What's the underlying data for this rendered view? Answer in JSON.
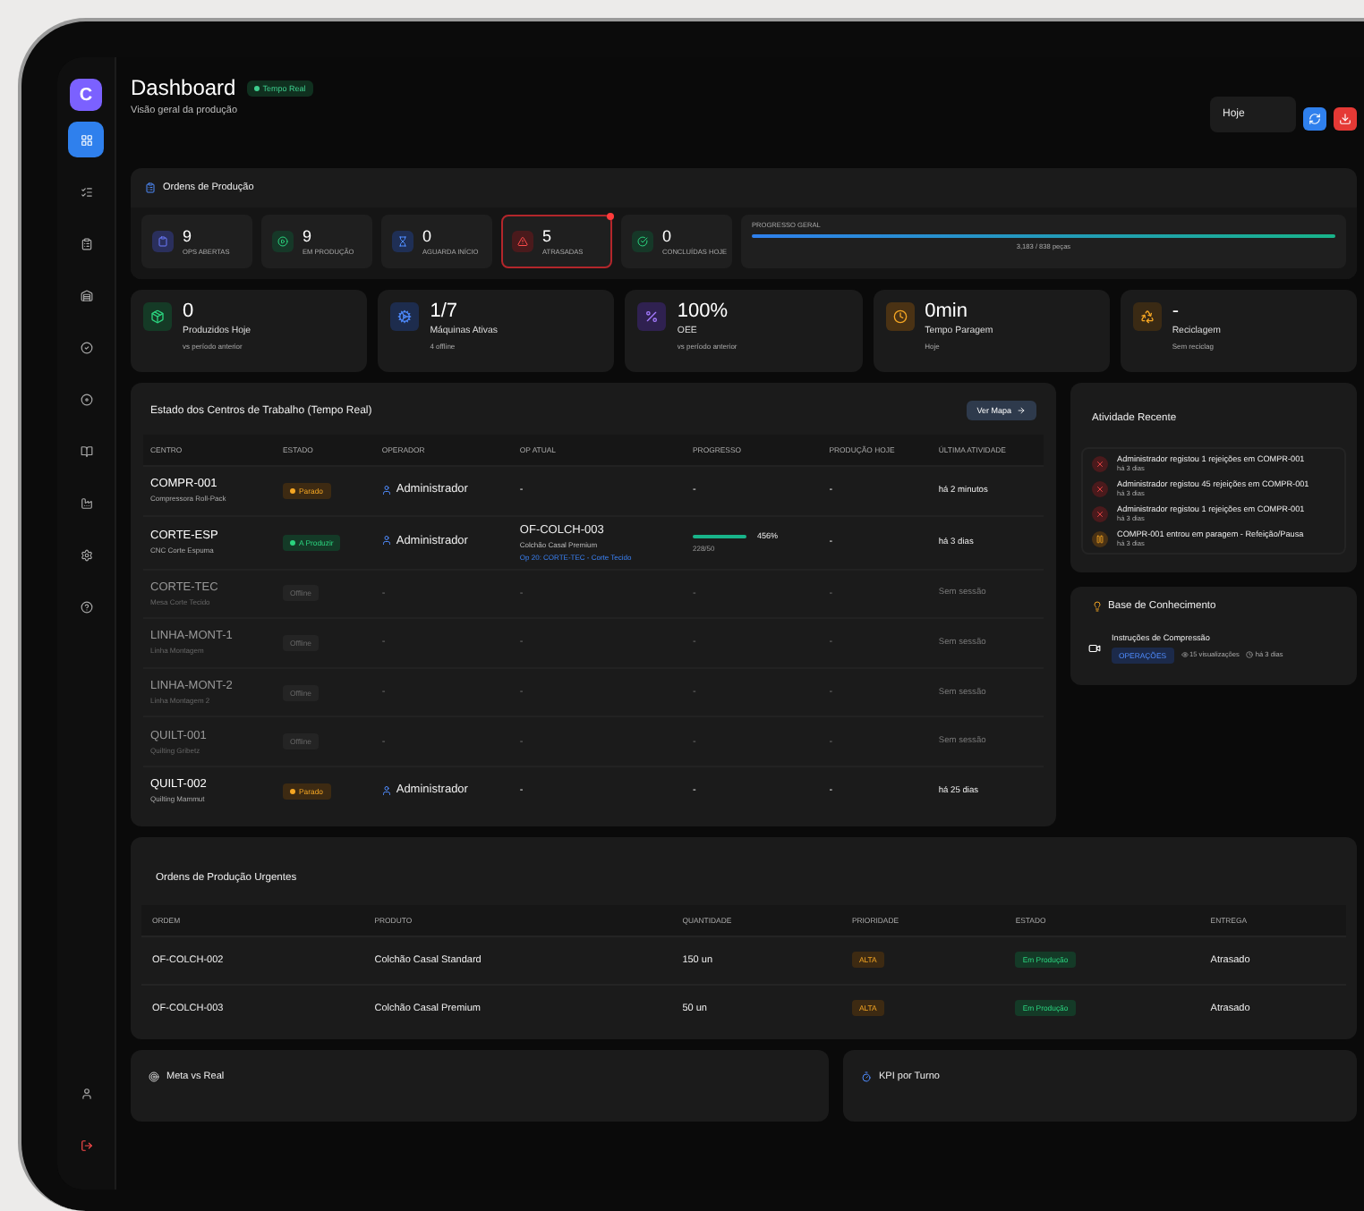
{
  "sidebar": {
    "logo": "C",
    "items": [
      {
        "selected": true
      },
      {
        "selected": false
      },
      {
        "selected": false
      },
      {
        "selected": false
      },
      {
        "selected": false
      },
      {
        "selected": false
      },
      {
        "selected": false
      },
      {
        "selected": false
      },
      {
        "selected": false
      },
      {
        "selected": false
      }
    ]
  },
  "header": {
    "title": "Dashboard",
    "badge": "Tempo Real",
    "subtitle": "Visão geral da produção",
    "period": "Hoje"
  },
  "orders_panel": {
    "title": "Ordens de Produção",
    "stats": [
      {
        "value": "9",
        "label": "OPS ABERTAS",
        "selected": false
      },
      {
        "value": "9",
        "label": "EM PRODUÇÃO",
        "selected": false
      },
      {
        "value": "0",
        "label": "AGUARDA INÍCIO",
        "selected": false
      },
      {
        "value": "5",
        "label": "ATRASADAS",
        "selected": true
      },
      {
        "value": "0",
        "label": "CONCLUÍDAS HOJE",
        "selected": false
      }
    ],
    "progress": {
      "label": "PROGRESSO GERAL",
      "level": 1,
      "reading": "3,183 / 838 peças"
    }
  },
  "kpis": [
    {
      "value": "0",
      "label": "Produzidos Hoje",
      "note": "vs período anterior"
    },
    {
      "value": "1/7",
      "label": "Máquinas Ativas",
      "note": "4 offline"
    },
    {
      "value": "100%",
      "label": "OEE",
      "note": "vs período anterior"
    },
    {
      "value": "0min",
      "label": "Tempo Paragem",
      "note": "Hoje"
    },
    {
      "value": "-",
      "label": "Reciclagem",
      "note": "Sem reciclag"
    }
  ],
  "work_centers": {
    "title": "Estado dos Centros de Trabalho (Tempo Real)",
    "button": "Ver Mapa",
    "columns": [
      "CENTRO",
      "ESTADO",
      "OPERADOR",
      "OP ATUAL",
      "PROGRESSO",
      "PRODUÇÃO HOJE",
      "ÚLTIMA ATIVIDADE"
    ],
    "rows": [
      {
        "code": "COMPR-001",
        "name": "Compressora Roll-Pack",
        "status": {
          "kind": "stopped",
          "label": "Parado"
        },
        "operator": "Administrador",
        "op": "-",
        "progress": "-",
        "today": "-",
        "last": "há 2 minutos"
      },
      {
        "code": "CORTE-ESP",
        "name": "CNC Corte Espuma",
        "status": {
          "kind": "running",
          "label": "A Produzir"
        },
        "operator": "Administrador",
        "op": {
          "code": "OF-COLCH-003",
          "product": "Colchão Casal Premium",
          "step": "Op 20: CORTE-TEC - Corte Tecido"
        },
        "progress": {
          "level": 1,
          "percent": "456%",
          "count": "228/50"
        },
        "today": "-",
        "last": "há 3 dias"
      },
      {
        "code": "CORTE-TEC",
        "name": "Mesa Corte Tecido",
        "status": {
          "kind": "offline",
          "label": "Offline"
        },
        "operator": "-",
        "op": "-",
        "progress": "-",
        "today": "-",
        "last": "Sem sessão"
      },
      {
        "code": "LINHA-MONT-1",
        "name": "Linha Montagem",
        "status": {
          "kind": "offline",
          "label": "Offline"
        },
        "operator": "-",
        "op": "-",
        "progress": "-",
        "today": "-",
        "last": "Sem sessão"
      },
      {
        "code": "LINHA-MONT-2",
        "name": "Linha Montagem 2",
        "status": {
          "kind": "offline",
          "label": "Offline"
        },
        "operator": "-",
        "op": "-",
        "progress": "-",
        "today": "-",
        "last": "Sem sessão"
      },
      {
        "code": "QUILT-001",
        "name": "Quilting Gribetz",
        "status": {
          "kind": "offline",
          "label": "Offline"
        },
        "operator": "-",
        "op": "-",
        "progress": "-",
        "today": "-",
        "last": "Sem sessão"
      },
      {
        "code": "QUILT-002",
        "name": "Quilting Mammut",
        "status": {
          "kind": "stopped",
          "label": "Parado"
        },
        "operator": "Administrador",
        "op": "-",
        "progress": "-",
        "today": "-",
        "last": "há 25 dias"
      }
    ]
  },
  "activity": {
    "title": "Atividade Recente",
    "items": [
      {
        "kind": "rejection",
        "text": "Administrador registou 1 rejeições em COMPR-001",
        "time": "há 3 dias"
      },
      {
        "kind": "rejection",
        "text": "Administrador registou 45 rejeições em COMPR-001",
        "time": "há 3 dias"
      },
      {
        "kind": "rejection",
        "text": "Administrador registou 1 rejeições em COMPR-001",
        "time": "há 3 dias"
      },
      {
        "kind": "pause",
        "text": "COMPR-001 entrou em paragem - Refeição/Pausa",
        "time": "há 3 dias"
      }
    ]
  },
  "knowledge": {
    "title": "Base de Conhecimento",
    "items": [
      {
        "title": "Instruções de Compressão",
        "tag": "OPERAÇÕES",
        "views": "15 visualizações",
        "time": "há 3 dias"
      }
    ]
  },
  "urgent": {
    "title": "Ordens de Produção Urgentes",
    "columns": [
      "ORDEM",
      "PRODUTO",
      "QUANTIDADE",
      "PRIORIDADE",
      "ESTADO",
      "ENTREGA"
    ],
    "rows": [
      {
        "order": "OF-COLCH-002",
        "product": "Colchão Casal Standard",
        "quantity": "150 un",
        "priority": "ALTA",
        "status": "Em Produção",
        "delivery": "Atrasado"
      },
      {
        "order": "OF-COLCH-003",
        "product": "Colchão Casal Premium",
        "quantity": "50 un",
        "priority": "ALTA",
        "status": "Em Produção",
        "delivery": "Atrasado"
      }
    ]
  },
  "bottom_panels": [
    {
      "kind": "target",
      "title": "Meta vs Real"
    },
    {
      "kind": "shift",
      "title": "KPI por Turno"
    }
  ]
}
